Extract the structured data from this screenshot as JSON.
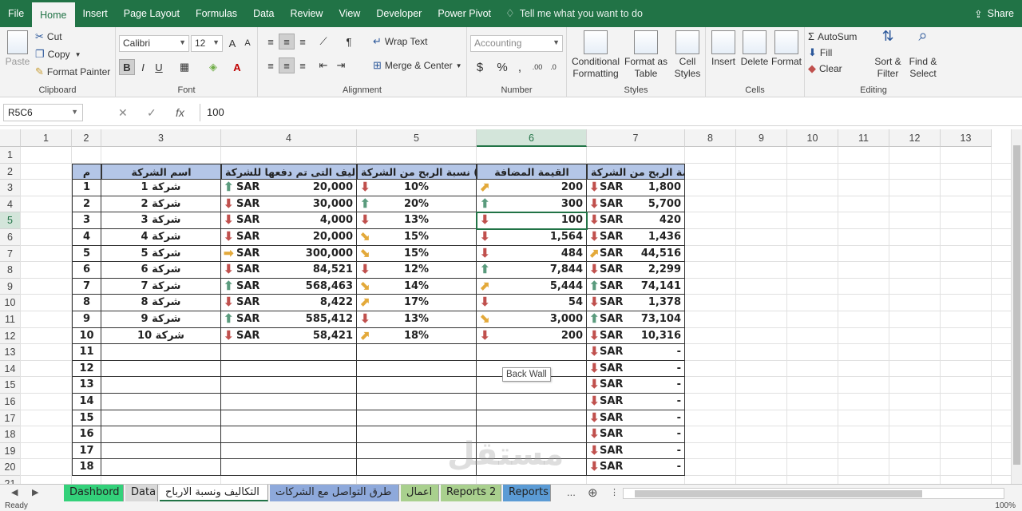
{
  "menu": {
    "tabs": [
      "File",
      "Home",
      "Insert",
      "Page Layout",
      "Formulas",
      "Data",
      "Review",
      "View",
      "Developer",
      "Power Pivot"
    ],
    "tell_me": "Tell me what you want to do",
    "share": "Share"
  },
  "ribbon": {
    "clipboard": {
      "paste": "Paste",
      "cut": "Cut",
      "copy": "Copy",
      "format_painter": "Format Painter",
      "label": "Clipboard"
    },
    "font": {
      "name": "Calibri",
      "size": "12",
      "bold": "B",
      "italic": "I",
      "underline": "U",
      "label": "Font"
    },
    "alignment": {
      "wrap": "Wrap Text",
      "merge": "Merge & Center",
      "label": "Alignment"
    },
    "number": {
      "format": "Accounting",
      "currency": "$",
      "percent": "%",
      "comma": ",",
      "label": "Number"
    },
    "styles": {
      "conditional": "Conditional",
      "conditional2": "Formatting",
      "format_as": "Format as",
      "format_as2": "Table",
      "cell": "Cell",
      "cell2": "Styles",
      "label": "Styles"
    },
    "cells": {
      "insert": "Insert",
      "delete": "Delete",
      "format": "Format",
      "label": "Cells"
    },
    "editing": {
      "autosum": "AutoSum",
      "fill": "Fill",
      "clear": "Clear",
      "sort": "Sort &",
      "sort2": "Filter",
      "find": "Find &",
      "find2": "Select",
      "label": "Editing"
    }
  },
  "formula_bar": {
    "name_box": "R5C6",
    "value": "100"
  },
  "columns": [
    "1",
    "2",
    "3",
    "4",
    "5",
    "6",
    "7",
    "8",
    "9",
    "10",
    "11",
    "12",
    "13"
  ],
  "rows": [
    "1",
    "2",
    "3",
    "4",
    "5",
    "6",
    "7",
    "8",
    "9",
    "10",
    "11",
    "12",
    "13",
    "14",
    "15",
    "16",
    "17",
    "18",
    "19",
    "20",
    "21"
  ],
  "table": {
    "headers": [
      "م",
      "اسم الشركة",
      "التكاليف التى تم دفعها للشركة",
      "نسبة الربح من الشركة (%)",
      "القيمة المضافة",
      "قيمة الربح من الشركة"
    ],
    "currency": "SAR",
    "rows": [
      {
        "n": "1",
        "name": "شركة 1",
        "cost": "20,000",
        "cost_dir": "up",
        "pct": "10%",
        "pct_dir": "down",
        "added": "200",
        "added_dir": "diag-up",
        "profit": "1,800",
        "profit_dir": "down"
      },
      {
        "n": "2",
        "name": "شركة 2",
        "cost": "30,000",
        "cost_dir": "down",
        "pct": "20%",
        "pct_dir": "up",
        "added": "300",
        "added_dir": "up",
        "profit": "5,700",
        "profit_dir": "down"
      },
      {
        "n": "3",
        "name": "شركة 3",
        "cost": "4,000",
        "cost_dir": "down",
        "pct": "13%",
        "pct_dir": "down",
        "added": "100",
        "added_dir": "down",
        "profit": "420",
        "profit_dir": "down"
      },
      {
        "n": "4",
        "name": "شركة 4",
        "cost": "20,000",
        "cost_dir": "down",
        "pct": "15%",
        "pct_dir": "diag-down",
        "added": "1,564",
        "added_dir": "down",
        "profit": "1,436",
        "profit_dir": "down"
      },
      {
        "n": "5",
        "name": "شركة 5",
        "cost": "300,000",
        "cost_dir": "right",
        "pct": "15%",
        "pct_dir": "diag-down",
        "added": "484",
        "added_dir": "down",
        "profit": "44,516",
        "profit_dir": "diag-up"
      },
      {
        "n": "6",
        "name": "شركة 6",
        "cost": "84,521",
        "cost_dir": "down",
        "pct": "12%",
        "pct_dir": "down",
        "added": "7,844",
        "added_dir": "up",
        "profit": "2,299",
        "profit_dir": "down"
      },
      {
        "n": "7",
        "name": "شركة 7",
        "cost": "568,463",
        "cost_dir": "up",
        "pct": "14%",
        "pct_dir": "diag-down",
        "added": "5,444",
        "added_dir": "diag-up",
        "profit": "74,141",
        "profit_dir": "up"
      },
      {
        "n": "8",
        "name": "شركة 8",
        "cost": "8,422",
        "cost_dir": "down",
        "pct": "17%",
        "pct_dir": "diag-up",
        "added": "54",
        "added_dir": "down",
        "profit": "1,378",
        "profit_dir": "down"
      },
      {
        "n": "9",
        "name": "شركة 9",
        "cost": "585,412",
        "cost_dir": "up",
        "pct": "13%",
        "pct_dir": "down",
        "added": "3,000",
        "added_dir": "diag-down",
        "profit": "73,104",
        "profit_dir": "up"
      },
      {
        "n": "10",
        "name": "شركة 10",
        "cost": "58,421",
        "cost_dir": "down",
        "pct": "18%",
        "pct_dir": "diag-up",
        "added": "200",
        "added_dir": "down",
        "profit": "10,316",
        "profit_dir": "down"
      }
    ],
    "empty_rows": [
      "11",
      "12",
      "13",
      "14",
      "15",
      "16",
      "17",
      "18"
    ],
    "empty_profit": "-"
  },
  "tooltip": "Back Wall",
  "watermark": "مستقل",
  "sheets": [
    {
      "name": "Dashbord",
      "color": "#33d17a"
    },
    {
      "name": "Data",
      "color": "#d9d9d9"
    },
    {
      "name": "التكاليف ونسبة الارباح",
      "color": "#ffffff"
    },
    {
      "name": "طرق التواصل مع الشركات",
      "color": "#8ea9db"
    },
    {
      "name": "اعمال",
      "color": "#a9d08e"
    },
    {
      "name": "Reports 2",
      "color": "#a9d08e"
    },
    {
      "name": "Reports",
      "color": "#5b9bd5"
    }
  ],
  "more_sheets": "...",
  "status": "Ready",
  "zoom": "100%"
}
